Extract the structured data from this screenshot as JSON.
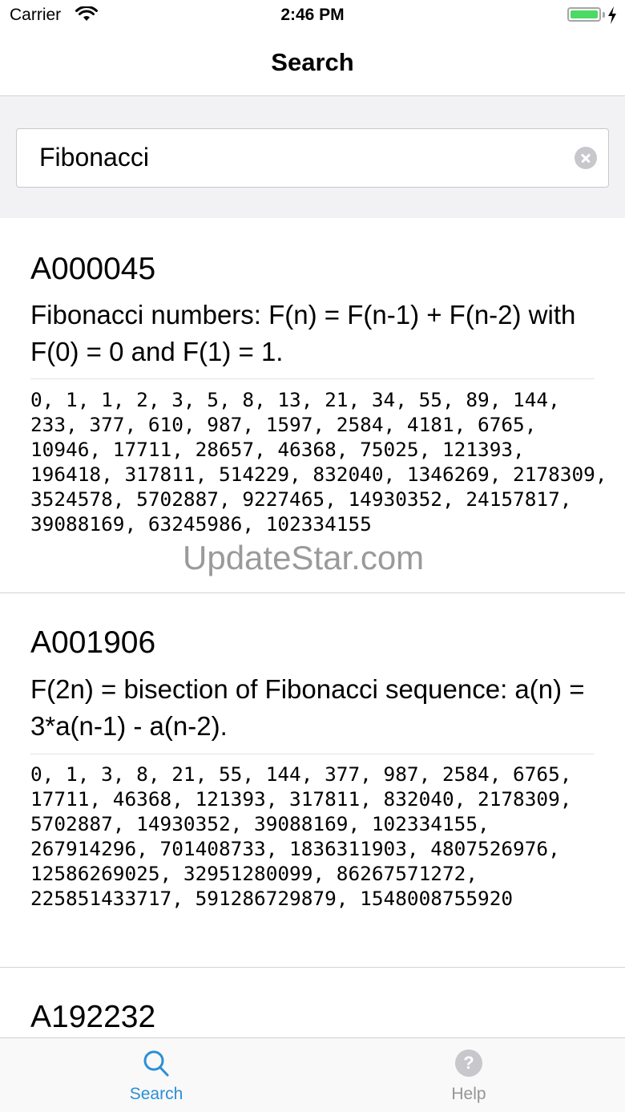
{
  "status_bar": {
    "carrier": "Carrier",
    "time": "2:46 PM",
    "battery_level": 1.0,
    "battery_color": "#4cd964"
  },
  "nav": {
    "title": "Search"
  },
  "search": {
    "query": "Fibonacci"
  },
  "results": [
    {
      "id": "A000045",
      "name": "Fibonacci numbers: F(n) = F(n-1) + F(n-2) with F(0) = 0 and F(1) = 1.",
      "sequence": "0, 1, 1, 2, 3, 5, 8, 13, 21, 34, 55, 89, 144, 233, 377, 610, 987, 1597, 2584, 4181, 6765, 10946, 17711, 28657, 46368, 75025, 121393, 196418, 317811, 514229, 832040, 1346269, 2178309, 3524578, 5702887, 9227465, 14930352, 24157817, 39088169, 63245986, 102334155"
    },
    {
      "id": "A001906",
      "name": "F(2n) = bisection of Fibonacci sequence: a(n) = 3*a(n-1) - a(n-2).",
      "sequence": "0, 1, 3, 8, 21, 55, 144, 377, 987, 2584, 6765, 17711, 46368, 121393, 317811, 832040, 2178309, 5702887, 14930352, 39088169, 102334155, 267914296, 701408733, 1836311903, 4807526976, 12586269025, 32951280099, 86267571272, 225851433717, 591286729879, 1548008755920"
    },
    {
      "id": "A192232"
    }
  ],
  "watermark": "UpdateStar.com",
  "tab_bar": {
    "tabs": [
      {
        "label": "Search",
        "icon": "search-icon",
        "selected": true
      },
      {
        "label": "Help",
        "icon": "help-icon",
        "selected": false
      }
    ],
    "active_color": "#2b8fd6",
    "inactive_color": "#959595"
  }
}
